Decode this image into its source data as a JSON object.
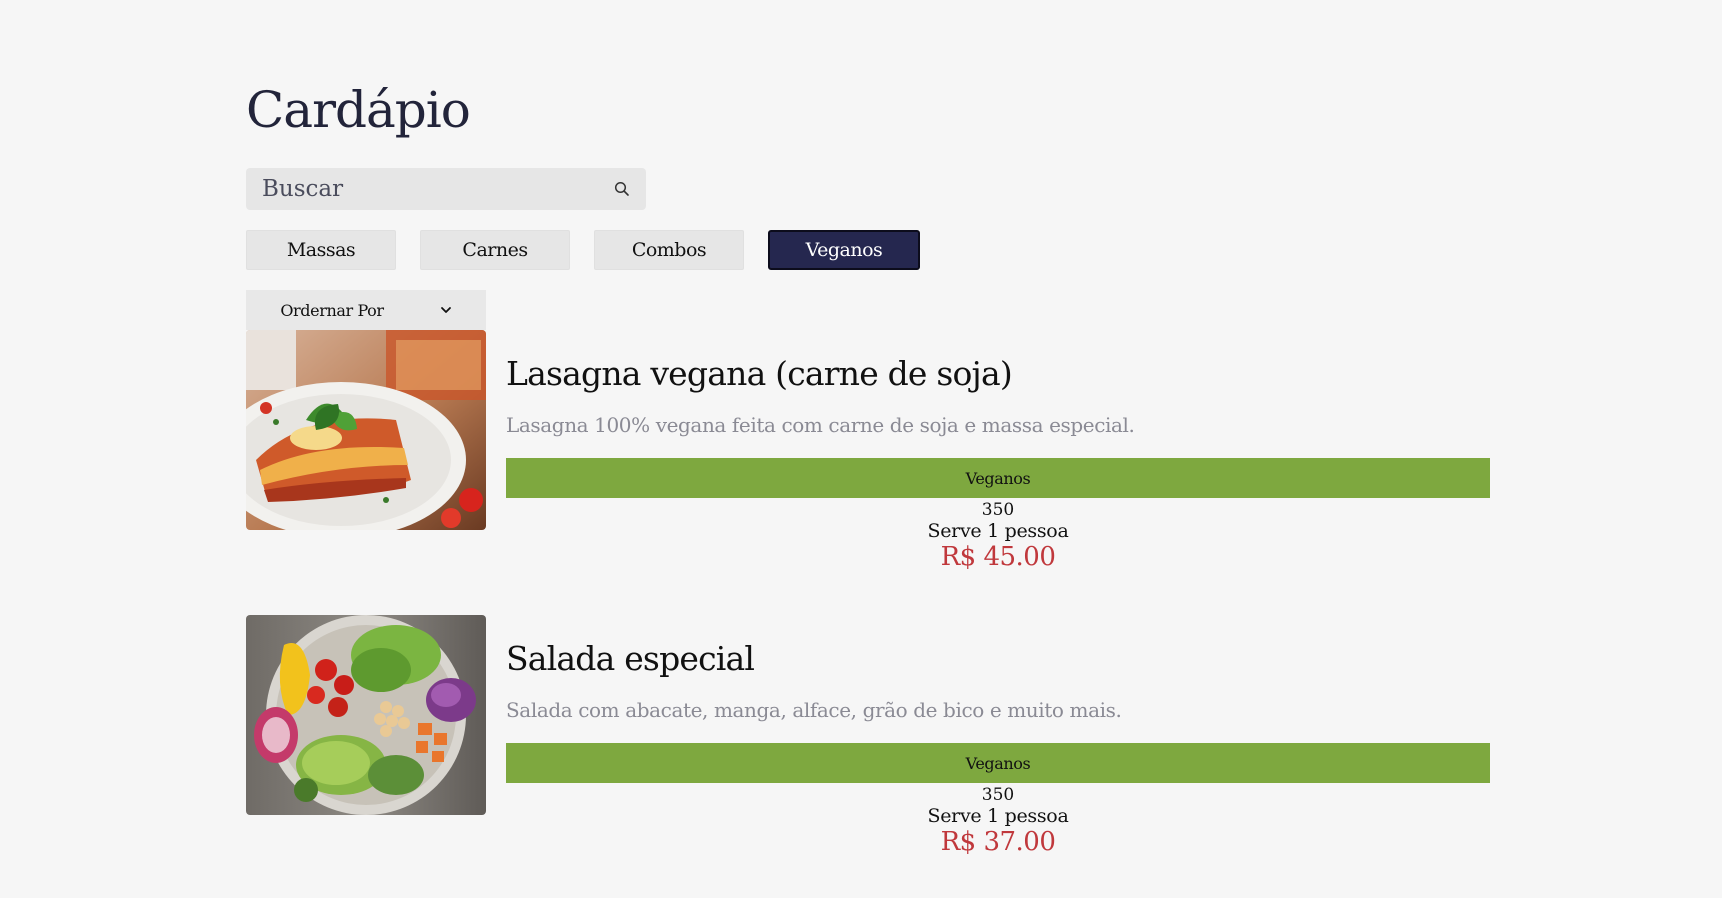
{
  "page": {
    "title": "Cardápio"
  },
  "search": {
    "placeholder": "Buscar",
    "icon": "search-icon"
  },
  "categories": [
    {
      "label": "Massas",
      "active": false
    },
    {
      "label": "Carnes",
      "active": false
    },
    {
      "label": "Combos",
      "active": false
    },
    {
      "label": "Veganos",
      "active": true
    }
  ],
  "sort": {
    "label": "Ordernar Por",
    "icon": "chevron-down-icon"
  },
  "colors": {
    "accent": "#25274f",
    "tag": "#7ea83f",
    "price": "#c0383c",
    "background": "#f6f6f6"
  },
  "items": [
    {
      "name": "Lasagna vegana (carne de soja)",
      "description": "Lasagna 100% vegana feita com carne de soja e massa especial.",
      "category": "Veganos",
      "weight": "350",
      "serves": "Serve 1 pessoa",
      "price": "R$ 45.00",
      "image": "lasagna-photo"
    },
    {
      "name": "Salada especial",
      "description": "Salada com abacate, manga, alface, grão de bico e muito mais.",
      "category": "Veganos",
      "weight": "350",
      "serves": "Serve 1 pessoa",
      "price": "R$ 37.00",
      "image": "salad-bowl-photo"
    }
  ]
}
